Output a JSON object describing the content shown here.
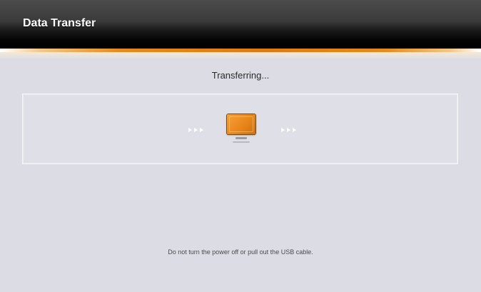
{
  "header": {
    "title": "Data Transfer"
  },
  "status": {
    "text": "Transferring..."
  },
  "transfer": {
    "device_icon": "monitor-icon",
    "arrow_icon": "arrow-dots-icon"
  },
  "warning": {
    "text": "Do not turn the power off or pull out the USB cable."
  },
  "colors": {
    "accent": "#e58a1e",
    "background": "#dcdde4",
    "header": "#000000"
  }
}
